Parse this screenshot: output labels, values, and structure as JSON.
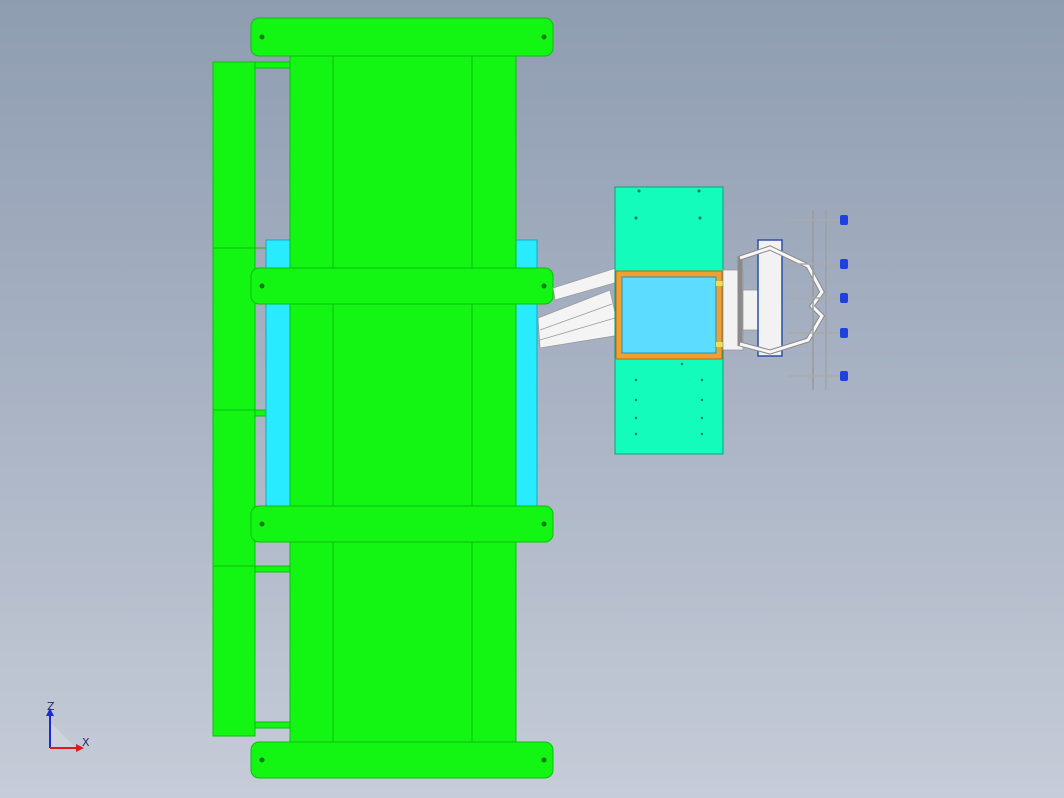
{
  "view": {
    "background_top": "#8f9db1",
    "background_bottom": "#c6ccd8"
  },
  "colors": {
    "conveyor_green": "#13f513",
    "conveyor_edge": "#0bbf0b",
    "roller_cyan": "#29ebff",
    "plate_teal": "#14fcbc",
    "window_blue": "#5cdcff",
    "frame_orange": "#f0a030",
    "arm_white": "#f2f2f2",
    "gripper_blue": "#2040e0"
  },
  "triad": {
    "z_label": "Z",
    "x_label": "X",
    "z_color": "#1a2bd6",
    "x_color": "#e01a1a"
  }
}
